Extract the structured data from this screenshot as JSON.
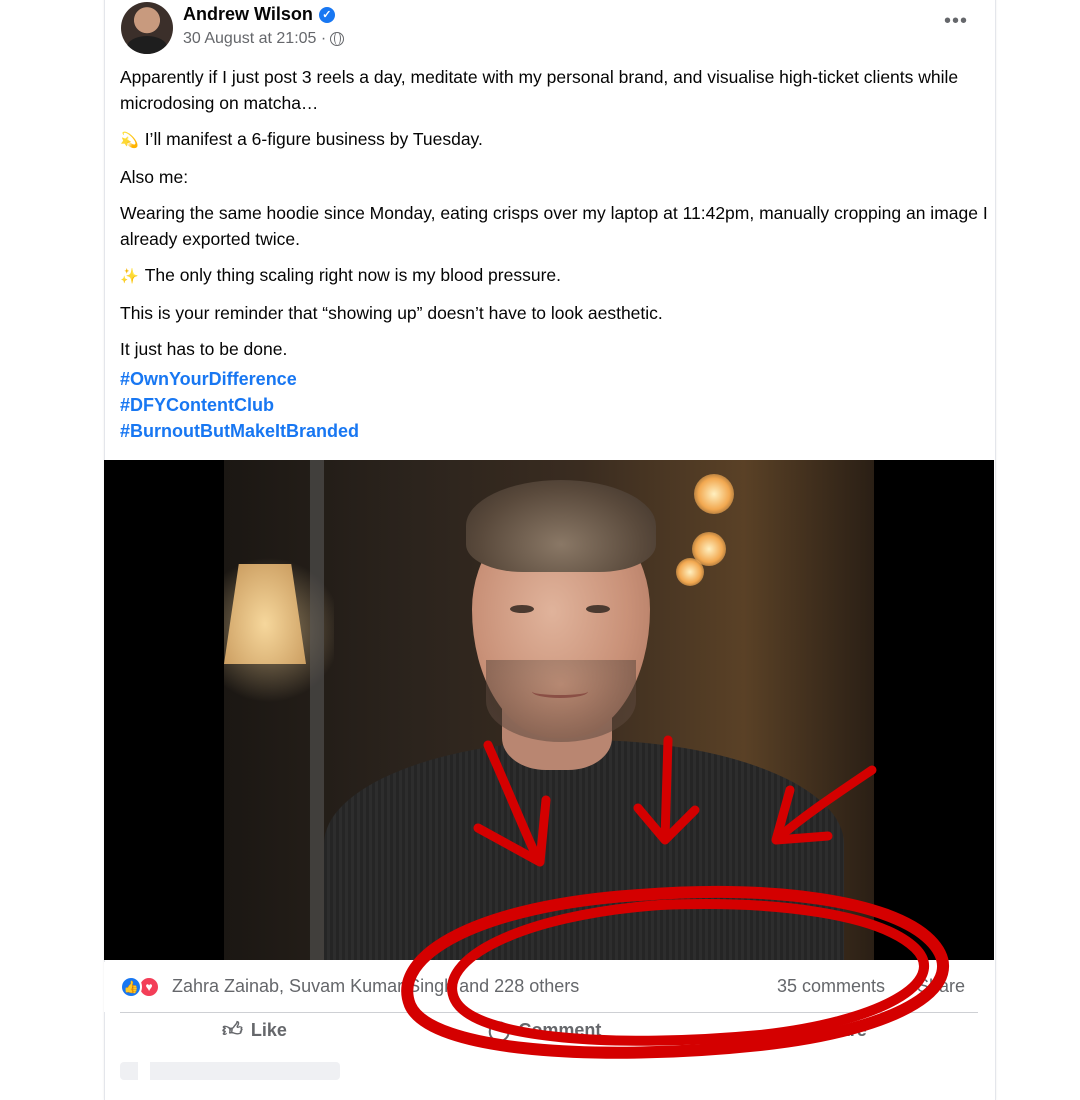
{
  "post": {
    "author": "Andrew Wilson",
    "timestamp": "30 August at 21:05 ·",
    "verified_icon": "verified-badge-icon",
    "privacy_icon": "globe-icon",
    "more_label": "•••",
    "paragraphs": [
      {
        "emoji": "",
        "text": "Apparently if I just post 3 reels a day, meditate with my personal brand, and visualise high-ticket clients while microdosing on matcha…"
      },
      {
        "emoji": "💫",
        "text": "I’ll manifest a 6-figure business by Tuesday."
      },
      {
        "emoji": "",
        "text": "Also me:"
      },
      {
        "emoji": "",
        "text": "Wearing the same hoodie since Monday, eating crisps over my laptop at 11:42pm, manually cropping an image I already exported twice."
      },
      {
        "emoji": "✨",
        "text": "The only thing scaling right now is my blood pressure."
      },
      {
        "emoji": "",
        "text": "This is your reminder that “showing up” doesn’t have to look aesthetic."
      },
      {
        "emoji": "",
        "text": "It just has to be done."
      }
    ],
    "hashtags": [
      "#OwnYourDifference",
      "#DFYContentClub",
      "#BurnoutButMakeItBranded"
    ]
  },
  "reactions": {
    "icons": [
      "like-reaction-icon",
      "love-reaction-icon"
    ],
    "names": "Zahra Zainab, Suvam Kumar Singh and 228 others",
    "comments": "35 comments",
    "shares": "Share"
  },
  "actions": {
    "like_label": "Like",
    "comment_label": "Comment",
    "share_label": "Share"
  },
  "colors": {
    "accent": "#1877f2",
    "annotation": "#d40000",
    "secondary_text": "#65676b"
  }
}
